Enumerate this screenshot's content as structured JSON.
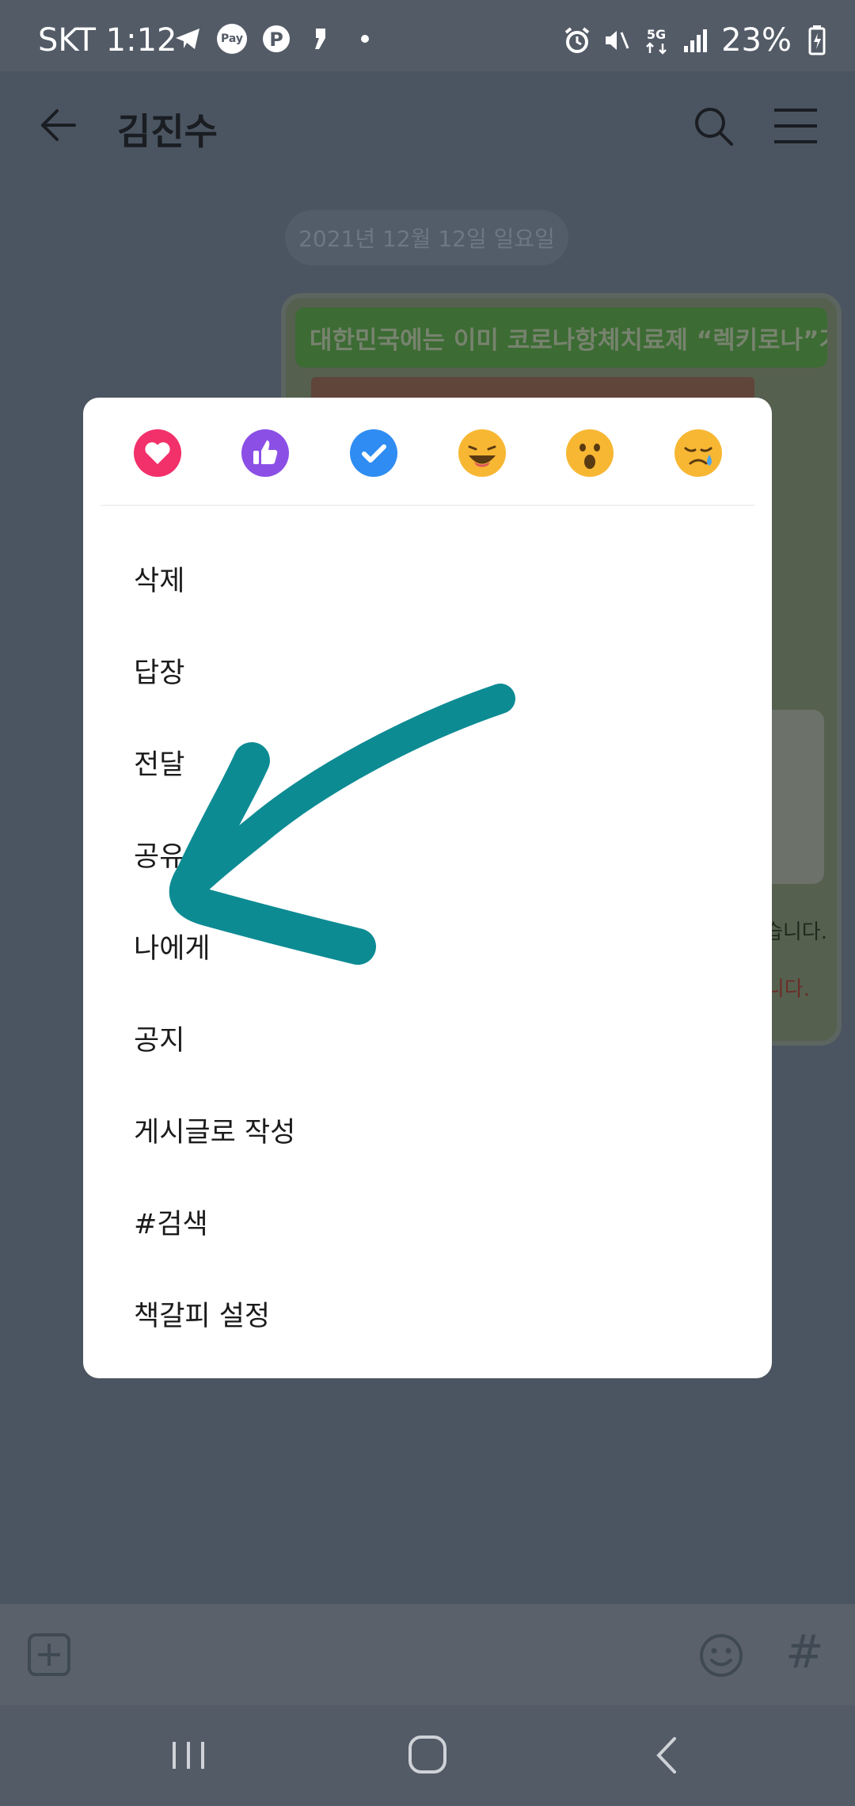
{
  "status_bar": {
    "carrier_time": "SKT 1:12",
    "pay_label": "Pay",
    "battery": "23%",
    "network": "5G",
    "icons_left": [
      "telegram-icon",
      "pay-icon",
      "pinterest-icon",
      "quote-icon",
      "dot-icon"
    ],
    "icons_right": [
      "alarm-icon",
      "mute-icon",
      "5g-icon",
      "signal-icon",
      "battery-icon"
    ]
  },
  "header": {
    "title": "김진수",
    "icons": [
      "back-arrow-icon",
      "search-icon",
      "menu-icon"
    ]
  },
  "chat": {
    "date": "2021년 12월 12일 일요일",
    "banner_text": "대한민국에는 이미 코로나항체치료제 “렉키로나”가 있습니다.",
    "partial_line_1": "습니다.",
    "partial_line_2": "니다."
  },
  "reactions": [
    {
      "name": "heart",
      "color": "#f2306a"
    },
    {
      "name": "thumbs-up",
      "color": "#8b4fe6"
    },
    {
      "name": "check",
      "color": "#2f8cf2"
    },
    {
      "name": "laugh",
      "color": "#f7b733"
    },
    {
      "name": "surprised",
      "color": "#f7b733"
    },
    {
      "name": "sad",
      "color": "#f7b733"
    }
  ],
  "menu": {
    "items": [
      "삭제",
      "답장",
      "전달",
      "공유",
      "나에게",
      "공지",
      "게시글로 작성",
      "#검색",
      "책갈피 설정"
    ]
  },
  "input_bar": {
    "hash_label": "#"
  },
  "annotation": {
    "arrow_color": "#0d8b93"
  }
}
